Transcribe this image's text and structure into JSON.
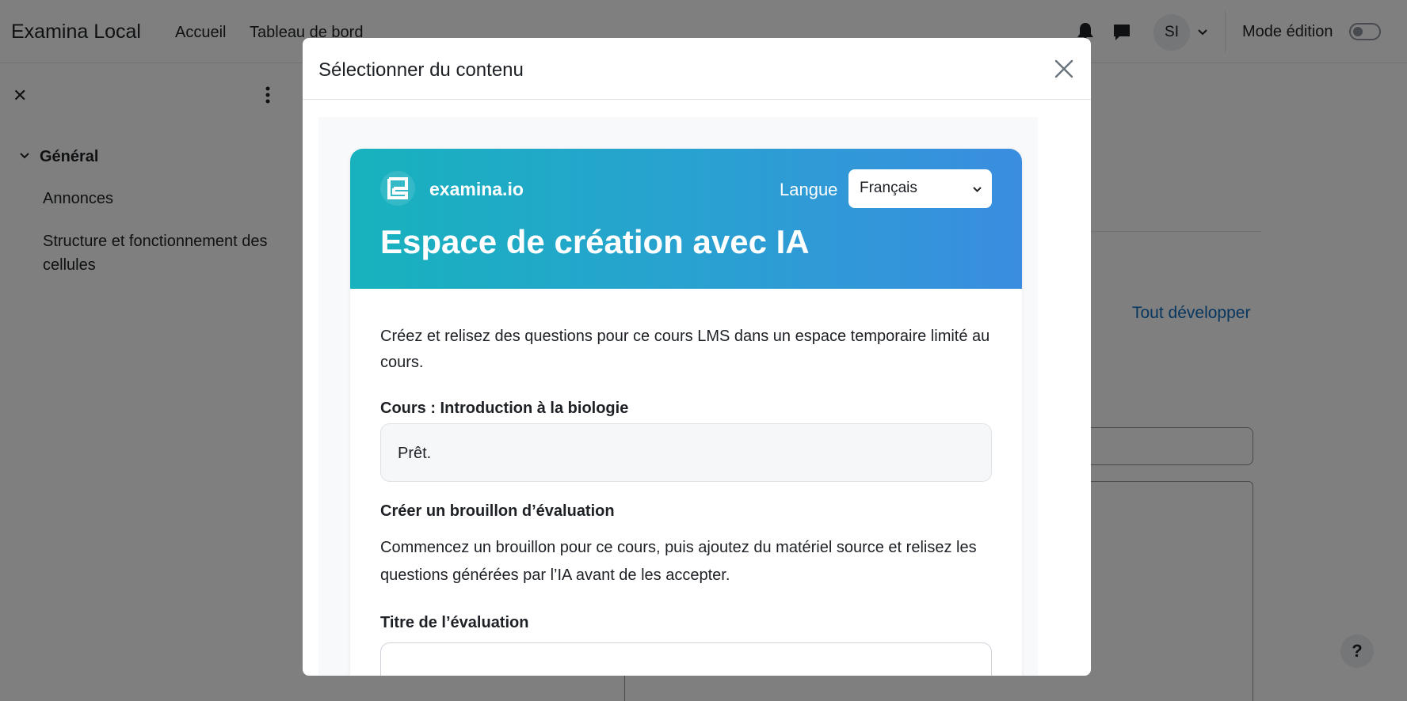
{
  "topbar": {
    "brand": "Examina Local",
    "nav": [
      "Accueil",
      "Tableau de bord"
    ],
    "avatar_initials": "SI",
    "edit_mode_label": "Mode édition",
    "edit_mode_on": false
  },
  "drawer": {
    "close_symbol": "✕",
    "section_title": "Général",
    "items": [
      "Annonces",
      "Structure et fonctionnement des cellules"
    ]
  },
  "page": {
    "expand_all": "Tout développer",
    "help_symbol": "?"
  },
  "modal": {
    "title": "Sélectionner du contenu",
    "card": {
      "logo_name": "examina.io",
      "language_label": "Langue",
      "language_value": "Français",
      "heading": "Espace de création avec IA",
      "intro": "Créez et relisez des questions pour ce cours LMS dans un espace temporaire limité au cours.",
      "course_label": "Cours : Introduction à la biologie",
      "status": "Prêt.",
      "draft_title": "Créer un brouillon d’évaluation",
      "draft_desc": "Commencez un brouillon pour ce cours, puis ajoutez du matériel source et relisez les questions générées par l’IA avant de les accepter.",
      "eval_title_label": "Titre de l’évaluation",
      "eval_title_value": ""
    }
  },
  "colors": {
    "header_gradient_start": "#17b2bd",
    "header_gradient_end": "#3a8de0",
    "link": "#0f6cbf"
  },
  "icons": [
    "bell-icon",
    "chat-icon",
    "chevron-down-icon",
    "kebab-menu-icon",
    "close-icon",
    "examina-logo-icon"
  ]
}
